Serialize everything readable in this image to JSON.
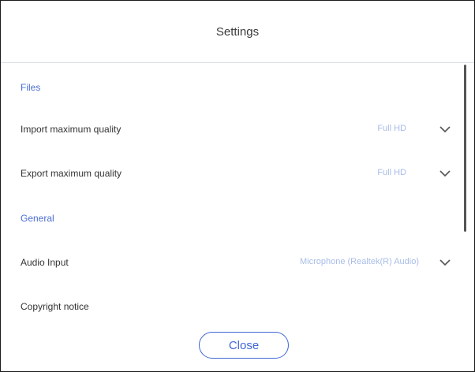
{
  "dialog": {
    "title": "Settings",
    "sections": {
      "files": "Files",
      "general": "General"
    },
    "rows": {
      "import_quality": {
        "label": "Import maximum quality",
        "value": "Full HD"
      },
      "export_quality": {
        "label": "Export maximum quality",
        "value": "Full HD"
      },
      "audio_input": {
        "label": "Audio Input",
        "value": "Microphone (Realtek(R) Audio)"
      },
      "copyright": {
        "label": "Copyright notice"
      }
    },
    "close_label": "Close"
  },
  "colors": {
    "accent": "#3f67d6",
    "section": "#4a6fd4",
    "value": "#a8bde8",
    "divider": "#d9dfe8"
  },
  "icons": {
    "dropdown": "chevron-down-icon"
  }
}
